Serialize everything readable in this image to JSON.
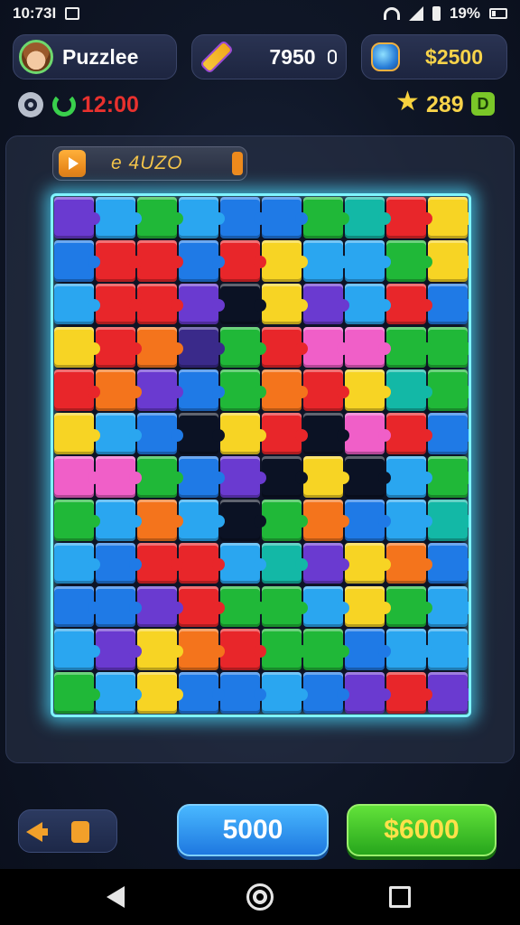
{
  "status_bar": {
    "time": "10:73I",
    "battery": "19%"
  },
  "header": {
    "player_name": "Puzzlee",
    "coins": "7950",
    "gems": "$2500"
  },
  "stats": {
    "timer": "12:00",
    "stars": "289"
  },
  "level": {
    "code": "e 4UZO"
  },
  "board": {
    "cols": 10,
    "rows": 12,
    "palette": {
      "R": "#e8262a",
      "O": "#f4741c",
      "Y": "#f7d424",
      "G": "#20b838",
      "B": "#1f7ae6",
      "C": "#2aa6f0",
      "P": "#f05fc8",
      "V": "#6a3ad0",
      "T": "#13b8a6",
      "D": "#0b1224",
      "K": "#3a2a8a"
    },
    "rows_data": [
      "VCGCBBGTRY",
      "BRRBRYCCGY",
      "CRRVDYVCRB",
      "YROKGRPPGG",
      "ROVBGORYTG",
      "YCBDYRDPRB",
      "PPGBVDYDCG",
      "GCOCDGOBCT",
      "CBRRCTVYOB",
      "BBVRGGCYGC",
      "CVYORGGBCC",
      "GCYBBCBVRV"
    ]
  },
  "actions": {
    "blue_button": "5000",
    "green_button": "$6000"
  }
}
